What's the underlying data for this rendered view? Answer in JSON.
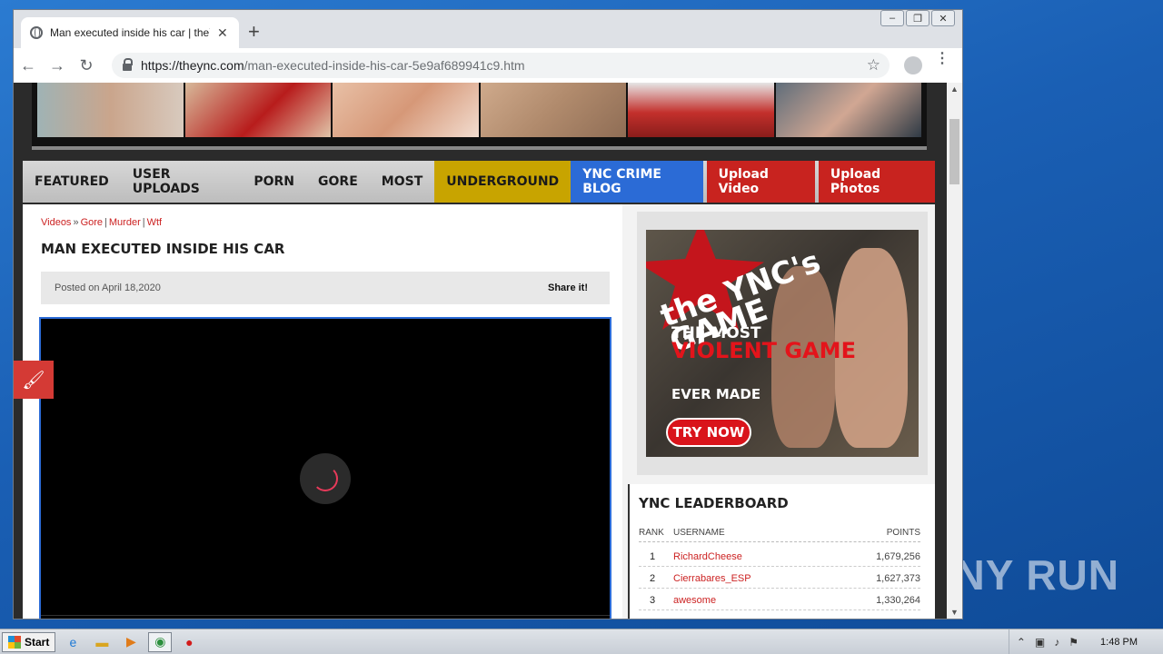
{
  "browser": {
    "tab_title": "Man executed inside his car | theYNC",
    "tab_close": "✕",
    "new_tab": "+",
    "url_host": "https://theync.com",
    "url_path": "/man-executed-inside-his-car-5e9af689941c9.htm",
    "back": "←",
    "forward": "→",
    "reload": "↻",
    "star": "☆",
    "menu": "⋮",
    "win_min": "–",
    "win_max": "❐",
    "win_close": "✕"
  },
  "nav": {
    "items": [
      "FEATURED",
      "USER UPLOADS",
      "PORN",
      "GORE",
      "MOST"
    ],
    "underground": "UNDERGROUND",
    "crime_blog": "YNC CRIME BLOG",
    "upload_video": "Upload Video",
    "upload_photos": "Upload Photos"
  },
  "breadcrumbs": {
    "videos": "Videos",
    "sep1": "»",
    "gore": "Gore",
    "sep2": "|",
    "murder": "Murder",
    "sep3": "|",
    "wtf": "Wtf"
  },
  "post": {
    "title": "MAN EXECUTED INSIDE HIS CAR",
    "posted": "Posted on April 18,2020",
    "share": "Share it!"
  },
  "ad": {
    "logo": "the YNC's GAME",
    "line1": "THE MOST",
    "line2": "VIOLENT GAME",
    "line3": "EVER MADE",
    "button": "TRY NOW"
  },
  "leaderboard": {
    "title": "YNC LEADERBOARD",
    "headers": {
      "rank": "RANK",
      "username": "USERNAME",
      "points": "POINTS"
    },
    "rows": [
      {
        "rank": "1",
        "username": "RichardCheese",
        "points": "1,679,256"
      },
      {
        "rank": "2",
        "username": "Cierrabares_ESP",
        "points": "1,627,373"
      },
      {
        "rank": "3",
        "username": "awesome",
        "points": "1,330,264"
      }
    ]
  },
  "taskbar": {
    "start": "Start",
    "clock": "1:48 PM"
  },
  "watermark": "ANY RUN",
  "colors": {
    "nav_yellow": "#c8a400",
    "nav_blue": "#2b6bd6",
    "nav_red": "#c8231f",
    "link_red": "#cc2222"
  }
}
